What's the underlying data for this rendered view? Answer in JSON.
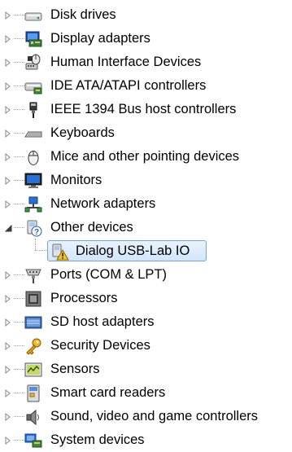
{
  "device_tree": {
    "items": [
      {
        "label": "Disk drives",
        "icon": "disk-drive-icon",
        "state": "collapsed"
      },
      {
        "label": "Display adapters",
        "icon": "display-adapter-icon",
        "state": "collapsed"
      },
      {
        "label": "Human Interface Devices",
        "icon": "hid-icon",
        "state": "collapsed"
      },
      {
        "label": "IDE ATA/ATAPI controllers",
        "icon": "ide-controller-icon",
        "state": "collapsed"
      },
      {
        "label": "IEEE 1394 Bus host controllers",
        "icon": "firewire-icon",
        "state": "collapsed"
      },
      {
        "label": "Keyboards",
        "icon": "keyboard-icon",
        "state": "collapsed"
      },
      {
        "label": "Mice and other pointing devices",
        "icon": "mouse-icon",
        "state": "collapsed"
      },
      {
        "label": "Monitors",
        "icon": "monitor-icon",
        "state": "collapsed"
      },
      {
        "label": "Network adapters",
        "icon": "network-adapter-icon",
        "state": "collapsed"
      },
      {
        "label": "Other devices",
        "icon": "unknown-device-icon",
        "state": "expanded"
      },
      {
        "label": "Ports (COM & LPT)",
        "icon": "port-icon",
        "state": "collapsed"
      },
      {
        "label": "Processors",
        "icon": "processor-icon",
        "state": "collapsed"
      },
      {
        "label": "SD host adapters",
        "icon": "sd-host-icon",
        "state": "collapsed"
      },
      {
        "label": "Security Devices",
        "icon": "security-key-icon",
        "state": "collapsed"
      },
      {
        "label": "Sensors",
        "icon": "sensor-icon",
        "state": "collapsed"
      },
      {
        "label": "Smart card readers",
        "icon": "smart-card-icon",
        "state": "collapsed"
      },
      {
        "label": "Sound, video and game controllers",
        "icon": "speaker-icon",
        "state": "collapsed"
      },
      {
        "label": "System devices",
        "icon": "system-device-icon",
        "state": "collapsed"
      }
    ],
    "child": {
      "label": "Dialog USB-Lab IO",
      "icon": "warning-device-icon",
      "selected": true
    },
    "colors": {
      "selection_border": "#7da2ce",
      "selection_fill": "#d9ebfc",
      "warning": "#f5c518"
    }
  }
}
